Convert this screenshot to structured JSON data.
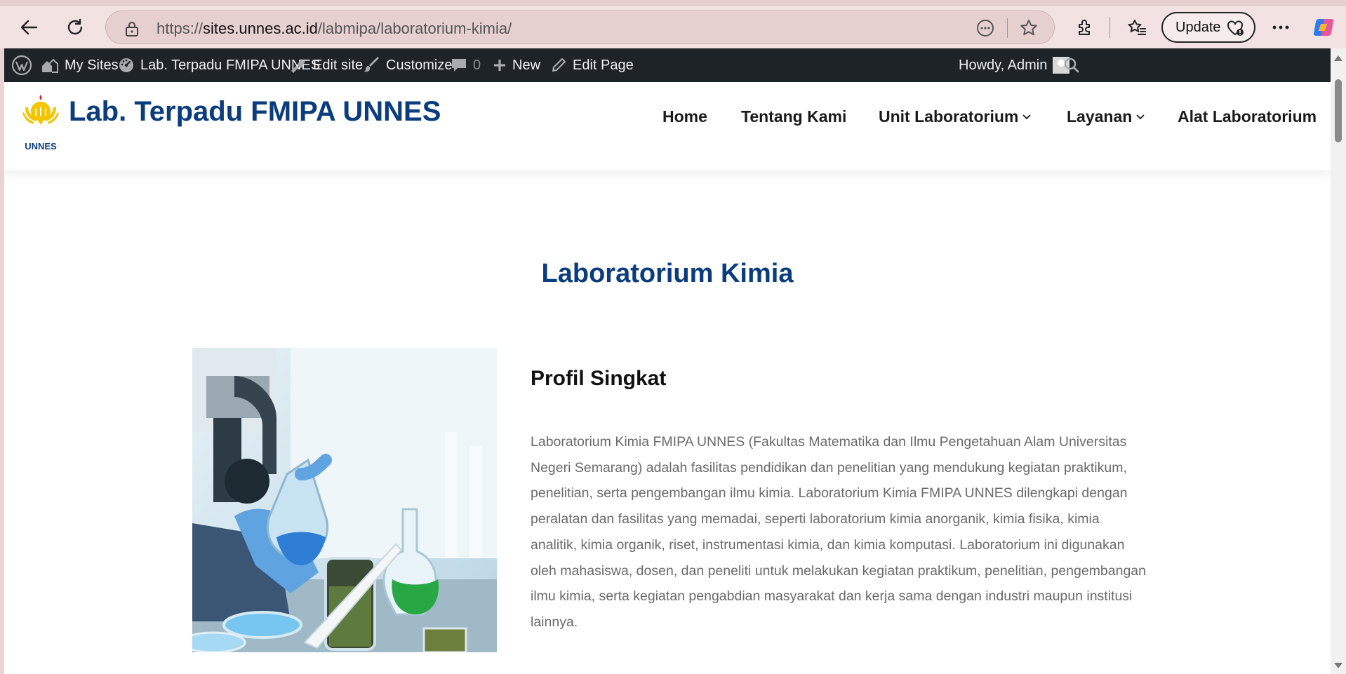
{
  "browser": {
    "url_scheme": "https://",
    "url_host": "sites.unnes.ac.id",
    "url_path": "/labmipa/laboratorium-kimia/",
    "update_label": "Update"
  },
  "adminbar": {
    "my_sites": "My Sites",
    "site_name": "Lab. Terpadu FMIPA UNNES",
    "edit_site": "Edit site",
    "customize": "Customize",
    "comments_count": "0",
    "new": "New",
    "edit_page": "Edit Page",
    "howdy": "Howdy, Admin"
  },
  "header": {
    "logo_text": "UNNES",
    "site_title": "Lab. Terpadu FMIPA UNNES",
    "menu": {
      "home": "Home",
      "about": "Tentang Kami",
      "units": "Unit Laboratorium",
      "services": "Layanan",
      "tools": "Alat Laboratorium"
    }
  },
  "main": {
    "page_title": "Laboratorium Kimia",
    "section_heading": "Profil Singkat",
    "profile_text": "Laboratorium Kimia FMIPA UNNES (Fakultas Matematika dan Ilmu Pengetahuan Alam Universitas Negeri Semarang) adalah fasilitas pendidikan dan penelitian yang mendukung kegiatan praktikum, penelitian, serta pengembangan ilmu kimia. Laboratorium Kimia FMIPA UNNES dilengkapi dengan peralatan dan fasilitas yang memadai, seperti laboratorium kimia anorganik, kimia fisika, kimia analitik, kimia organik, riset, instrumentasi kimia, dan kimia komputasi. Laboratorium ini digunakan oleh mahasiswa, dosen, dan peneliti untuk melakukan kegiatan praktikum, penelitian, pengembangan ilmu kimia, serta kegiatan pengabdian masyarakat dan kerja sama dengan industri maupun institusi lainnya."
  },
  "colors": {
    "brand_blue": "#0b3c7d",
    "adminbar_bg": "#1d2327",
    "body_text": "#6a6a6a",
    "logo_yellow": "#f2c500"
  }
}
